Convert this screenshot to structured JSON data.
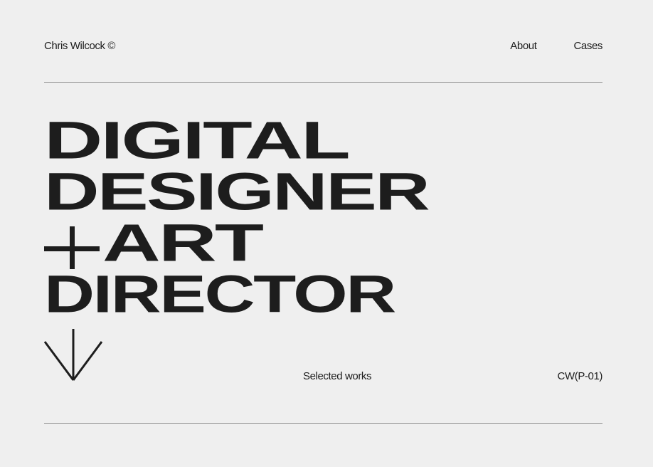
{
  "header": {
    "brand": "Chris Wilcock ©",
    "nav": [
      {
        "label": "About"
      },
      {
        "label": "Cases"
      }
    ]
  },
  "hero": {
    "lines": [
      "DIGITAL",
      "DESIGNER",
      "ART",
      "DIRECTOR"
    ],
    "plus_icon": "plus-icon",
    "arrow_icon": "arrow-down-icon"
  },
  "footer_row": {
    "label": "Selected works",
    "code": "CW(P-01)"
  },
  "colors": {
    "background": "#efefef",
    "text": "#1d1d1d",
    "rule": "#8e8e8e"
  }
}
